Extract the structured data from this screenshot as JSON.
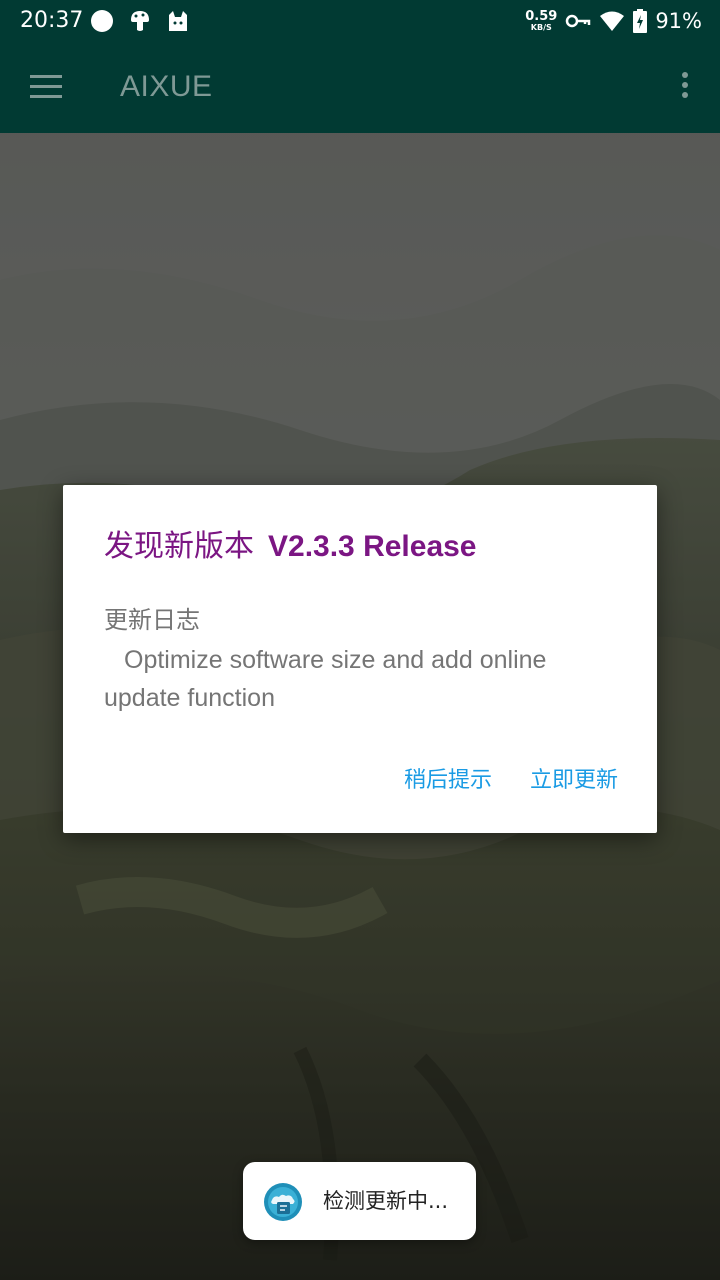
{
  "status_bar": {
    "time": "20:37",
    "left_icons": [
      "circle-notification-icon",
      "mushroom-icon",
      "cat-icon"
    ],
    "net_speed_value": "0.59",
    "net_speed_unit": "KB/S",
    "right_icons": [
      "vpn-key-icon",
      "wifi-icon",
      "battery-charging-icon"
    ],
    "battery_percent": "91%"
  },
  "app_bar": {
    "title": "AIXUE",
    "menu_icon": "hamburger-menu-icon",
    "overflow_icon": "more-vert-icon",
    "background_color": "#013a33"
  },
  "dialog": {
    "title": "发现新版本",
    "version": "V2.3.3 Release",
    "log_heading": "更新日志",
    "log_body": "Optimize software size and add online update function",
    "later_button": "稍后提示",
    "update_button": "立即更新",
    "title_color": "#7b1683",
    "button_color": "#1a9be4"
  },
  "toast": {
    "icon": "app-logo-icon",
    "text": "检测更新中..."
  }
}
